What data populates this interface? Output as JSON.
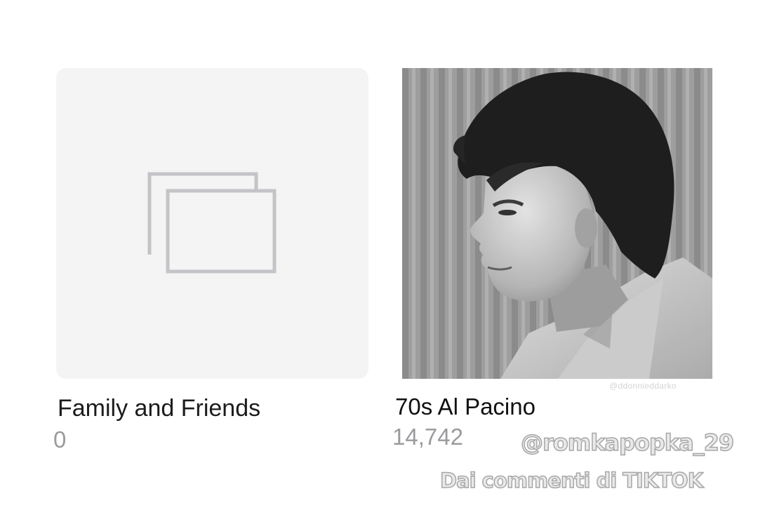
{
  "albums": [
    {
      "name": "Family and Friends",
      "count": "0",
      "thumbnail": "empty-album-placeholder-icon"
    },
    {
      "name": "70s Al Pacino",
      "count": "14,742",
      "thumbnail": "black-and-white-portrait-photo",
      "photo_credit": "@ddonnieddarko"
    }
  ],
  "overlay": {
    "handle": "@romkapopka_29",
    "source": "Dai commenti di TIKTOK"
  },
  "colors": {
    "background": "#ffffff",
    "placeholder_bg": "#f4f4f5",
    "placeholder_icon": "#c7c7cc",
    "title_text": "#1c1c1e",
    "count_text": "#9b9b9f"
  }
}
